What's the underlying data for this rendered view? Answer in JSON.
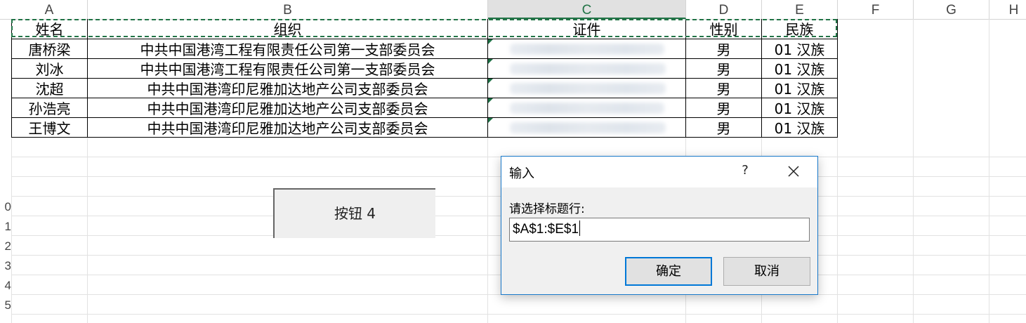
{
  "columns": [
    "A",
    "B",
    "C",
    "D",
    "E",
    "F",
    "G",
    "H"
  ],
  "rows": [
    "0",
    "1",
    "2",
    "3",
    "4",
    "5"
  ],
  "table": {
    "headers": [
      "姓名",
      "组织",
      "证件",
      "性别",
      "民族"
    ],
    "rows": [
      {
        "name": "唐桥梁",
        "org": "中共中国港湾工程有限责任公司第一支部委员会",
        "gender": "男",
        "ethnic": "01 汉族"
      },
      {
        "name": "刘冰",
        "org": "中共中国港湾工程有限责任公司第一支部委员会",
        "gender": "男",
        "ethnic": "01 汉族"
      },
      {
        "name": "沈超",
        "org": "中共中国港湾印尼雅加达地产公司支部委员会",
        "gender": "男",
        "ethnic": "01 汉族"
      },
      {
        "name": "孙浩亮",
        "org": "中共中国港湾印尼雅加达地产公司支部委员会",
        "gender": "男",
        "ethnic": "01 汉族"
      },
      {
        "name": "王博文",
        "org": "中共中国港湾印尼雅加达地产公司支部委员会",
        "gender": "男",
        "ethnic": "01 汉族"
      }
    ]
  },
  "form_button": {
    "label": "按钮 4"
  },
  "dialog": {
    "title": "输入",
    "help": "?",
    "prompt": "请选择标题行:",
    "value": "$A$1:$E$1",
    "ok": "确定",
    "cancel": "取消"
  },
  "colors": {
    "accent_green": "#217346",
    "dialog_border": "#1979ca",
    "default_button": "#0078d7"
  },
  "icons": [
    "close-icon",
    "help-icon"
  ]
}
